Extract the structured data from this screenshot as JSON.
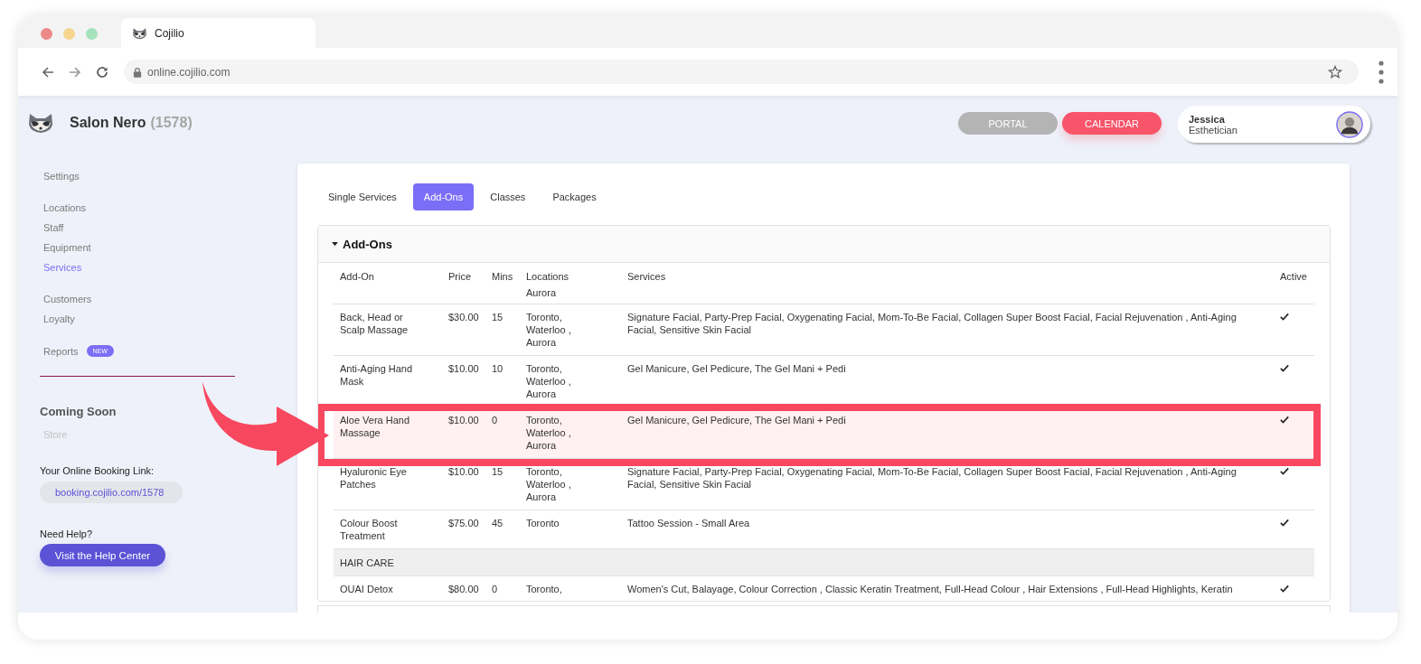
{
  "browser": {
    "tab_title": "Cojilio",
    "url": "online.cojilio.com"
  },
  "header": {
    "salon_name": "Salon Nero",
    "salon_id": "(1578)",
    "buttons": [
      {
        "label": "PORTAL",
        "selected": false
      },
      {
        "label": "CALENDAR",
        "selected": true
      }
    ],
    "user": {
      "name": "Jessica",
      "role": "Esthetician"
    }
  },
  "sidebar": {
    "groups": [
      {
        "items": [
          {
            "label": "Settings",
            "selected": false
          }
        ]
      },
      {
        "items": [
          {
            "label": "Locations",
            "selected": false
          },
          {
            "label": "Staff",
            "selected": false
          },
          {
            "label": "Equipment",
            "selected": false
          },
          {
            "label": "Services",
            "selected": true
          }
        ]
      },
      {
        "items": [
          {
            "label": "Customers",
            "selected": false
          },
          {
            "label": "Loyalty",
            "selected": false
          }
        ]
      },
      {
        "items": [
          {
            "label": "Reports",
            "selected": false,
            "badge": "NEW"
          }
        ]
      }
    ],
    "coming_soon": {
      "title": "Coming Soon",
      "items": [
        {
          "label": "Store",
          "disabled": true
        }
      ]
    },
    "booking_link": {
      "label": "Your Online Booking Link:",
      "url": "booking.cojilio.com/1578"
    },
    "help": {
      "label": "Need Help?",
      "button": "Visit the Help Center"
    }
  },
  "tabs": [
    {
      "label": "Single Services",
      "selected": false
    },
    {
      "label": "Add-Ons",
      "selected": true
    },
    {
      "label": "Classes",
      "selected": false
    },
    {
      "label": "Packages",
      "selected": false
    }
  ],
  "panel": {
    "title": "Add-Ons",
    "expanded": true,
    "columns": [
      "Add-On",
      "Price",
      "Mins",
      "Locations",
      "Services",
      "Active"
    ],
    "header_remnant": {
      "locations": "Aurora"
    },
    "rows": [
      {
        "kind": "item",
        "name": "Back, Head or Scalp Massage",
        "price": "$30.00",
        "mins": "15",
        "locations": "Toronto, Waterloo , Aurora",
        "services": "Signature Facial, Party-Prep Facial, Oxygenating Facial, Mom-To-Be Facial, Collagen Super Boost Facial, Facial Rejuvenation , Anti-Aging Facial, Sensitive Skin Facial",
        "active": true,
        "highlighted": false
      },
      {
        "kind": "item",
        "name": "Anti-Aging Hand Mask",
        "price": "$10.00",
        "mins": "10",
        "locations": "Toronto, Waterloo , Aurora",
        "services": "Gel Manicure, Gel Pedicure, The Gel Mani + Pedi",
        "active": true,
        "highlighted": false
      },
      {
        "kind": "item",
        "name": "Aloe Vera Hand Massage",
        "price": "$10.00",
        "mins": "0",
        "locations": "Toronto, Waterloo , Aurora",
        "services": "Gel Manicure, Gel Pedicure, The Gel Mani + Pedi",
        "active": true,
        "highlighted": true
      },
      {
        "kind": "item",
        "name": "Hyaluronic Eye Patches",
        "price": "$10.00",
        "mins": "15",
        "locations": "Toronto, Waterloo , Aurora",
        "services": "Signature Facial, Party-Prep Facial, Oxygenating Facial, Mom-To-Be Facial, Collagen Super Boost Facial, Facial Rejuvenation , Anti-Aging Facial, Sensitive Skin Facial",
        "active": true,
        "highlighted": false
      },
      {
        "kind": "item",
        "name": "Colour Boost Treatment",
        "price": "$75.00",
        "mins": "45",
        "locations": "Toronto",
        "services": "Tattoo Session - Small Area",
        "active": true,
        "highlighted": false
      },
      {
        "kind": "category",
        "name": "HAIR CARE"
      },
      {
        "kind": "item",
        "name": "OUAI Detox",
        "price": "$80.00",
        "mins": "0",
        "locations": "Toronto,",
        "services": "Women's Cut, Balayage, Colour Correction , Classic Keratin Treatment, Full-Head Colour , Hair Extensions , Full-Head Highlights, Keratin",
        "active": true,
        "highlighted": false
      }
    ]
  }
}
